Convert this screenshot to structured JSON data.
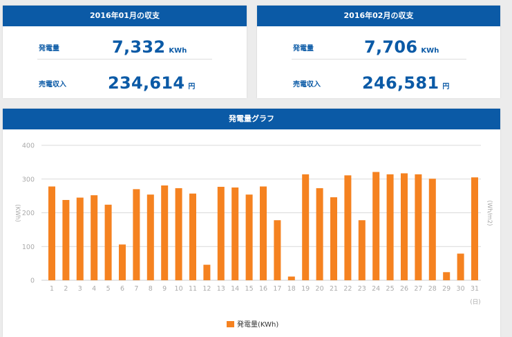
{
  "summary": [
    {
      "title": "2016年01月の収支",
      "generation_label": "発電量",
      "generation_value": "7,332",
      "generation_unit": "KWh",
      "revenue_label": "売電収入",
      "revenue_value": "234,614",
      "revenue_unit": "円"
    },
    {
      "title": "2016年02月の収支",
      "generation_label": "発電量",
      "generation_value": "7,706",
      "generation_unit": "KWh",
      "revenue_label": "売電収入",
      "revenue_value": "246,581",
      "revenue_unit": "円"
    }
  ],
  "chart_card": {
    "title": "発電量グラフ"
  },
  "colors": {
    "header": "#0b5aa6",
    "bar": "#f58220",
    "grid": "#d9d9d9"
  },
  "chart_data": {
    "type": "bar",
    "title": "発電量グラフ",
    "categories": [
      "1",
      "2",
      "3",
      "4",
      "5",
      "6",
      "7",
      "8",
      "9",
      "10",
      "11",
      "12",
      "13",
      "14",
      "15",
      "16",
      "17",
      "18",
      "19",
      "20",
      "21",
      "22",
      "23",
      "24",
      "25",
      "26",
      "27",
      "28",
      "29",
      "30",
      "31"
    ],
    "x_unit": "(日)",
    "y_left_label": "(KWh)",
    "y_right_label": "(Wh/m2)",
    "ylim": [
      0,
      400
    ],
    "yticks": [
      0,
      100,
      200,
      300,
      400
    ],
    "grid": true,
    "legend_position": "bottom-center",
    "series": [
      {
        "name": "発電量(KWh)",
        "values": [
          278,
          238,
          245,
          252,
          224,
          106,
          270,
          254,
          281,
          273,
          257,
          46,
          277,
          275,
          254,
          278,
          178,
          11,
          314,
          273,
          246,
          311,
          178,
          321,
          314,
          317,
          314,
          301,
          24,
          79,
          305
        ]
      }
    ]
  }
}
